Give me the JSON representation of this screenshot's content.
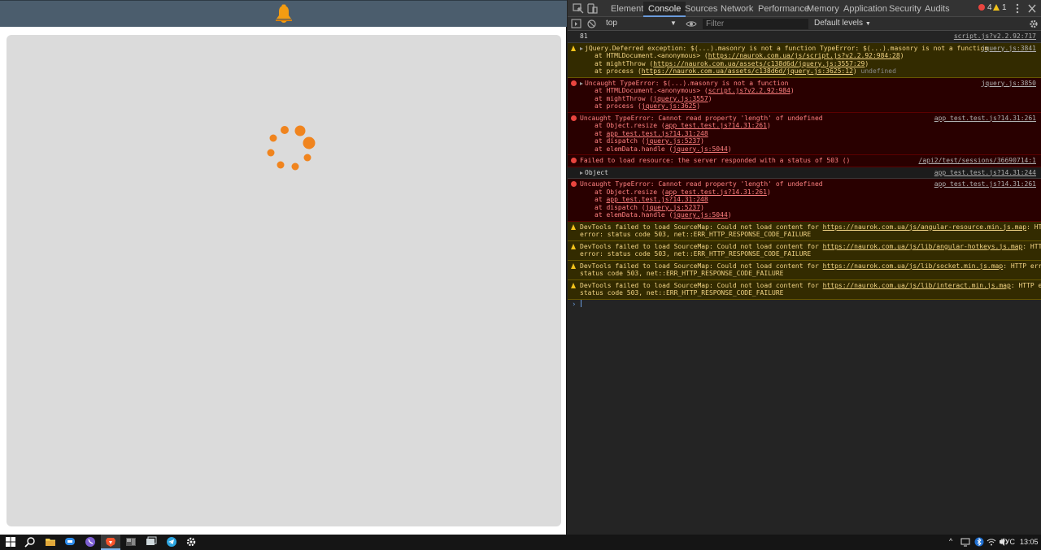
{
  "devtools": {
    "tabs": [
      "Elements",
      "Console",
      "Sources",
      "Network",
      "Performance",
      "Memory",
      "Application",
      "Security",
      "Audits"
    ],
    "active_tab": "Console",
    "error_count": "4",
    "warning_count": "1"
  },
  "toolbar": {
    "context": "top",
    "filter_placeholder": "Filter",
    "levels": "Default levels"
  },
  "console": {
    "r0": {
      "text": "81",
      "src": "script.js?v2.2.92:717"
    },
    "r1": {
      "l1": "jQuery.Deferred exception: $(...).masonry is not a function TypeError: $(...).masonry is not a function",
      "src": "jquery.js:3841",
      "l2a": "at HTMLDocument.<anonymous> (",
      "l2b": "https://naurok.com.ua/js/script.js?v2.2.92:984:28",
      "l2c": ")",
      "l3a": "at mightThrow (",
      "l3b": "https://naurok.com.ua/assets/c138d6d/jquery.js:3557:29",
      "l3c": ")",
      "l4a": "at process (",
      "l4b": "https://naurok.com.ua/assets/c138d6d/jquery.js:3625:12",
      "l4c": ") ",
      "l4d": "undefined"
    },
    "r2": {
      "l1": "Uncaught TypeError: $(...).masonry is not a function",
      "src": "jquery.js:3850",
      "l2a": "at HTMLDocument.<anonymous> (",
      "l2b": "script.js?v2.2.92:984",
      "l2c": ")",
      "l3a": "at mightThrow (",
      "l3b": "jquery.js:3557",
      "l3c": ")",
      "l4a": "at process (",
      "l4b": "jquery.js:3625",
      "l4c": ")"
    },
    "r3": {
      "l1": "Uncaught TypeError: Cannot read property 'length' of undefined",
      "src": "app_test.test.js?14.31:261",
      "l2a": "at Object.resize (",
      "l2b": "app_test.test.js?14.31:261",
      "l2c": ")",
      "l3a": "at ",
      "l3b": "app_test.test.js?14.31:248",
      "l4a": "at dispatch (",
      "l4b": "jquery.js:5237",
      "l4c": ")",
      "l5a": "at elemData.handle (",
      "l5b": "jquery.js:5044",
      "l5c": ")"
    },
    "r4": {
      "text": "Failed to load resource: the server responded with a status of 503 ()",
      "src": "/api2/test/sessions/36690714:1"
    },
    "r5": {
      "text": "Object",
      "src": "app_test.test.js?14.31:244"
    },
    "r6": {
      "l1": "Uncaught TypeError: Cannot read property 'length' of undefined",
      "src": "app_test.test.js?14.31:261",
      "l2a": "at Object.resize (",
      "l2b": "app_test.test.js?14.31:261",
      "l2c": ")",
      "l3a": "at ",
      "l3b": "app_test.test.js?14.31:248",
      "l4a": "at dispatch (",
      "l4b": "jquery.js:5237",
      "l4c": ")",
      "l5a": "at elemData.handle (",
      "l5b": "jquery.js:5044",
      "l5c": ")"
    },
    "r7": {
      "a": "DevTools failed to load SourceMap: Could not load content for ",
      "b": "https://naurok.com.ua/js/angular-resource.min.js.map",
      "c": ": HTTP",
      "d": "error: status code 503, net::ERR_HTTP_RESPONSE_CODE_FAILURE"
    },
    "r8": {
      "a": "DevTools failed to load SourceMap: Could not load content for ",
      "b": "https://naurok.com.ua/js/lib/angular-hotkeys.js.map",
      "c": ": HTTP",
      "d": "error: status code 503, net::ERR_HTTP_RESPONSE_CODE_FAILURE"
    },
    "r9": {
      "a": "DevTools failed to load SourceMap: Could not load content for ",
      "b": "https://naurok.com.ua/js/lib/socket.min.js.map",
      "c": ": HTTP error:",
      "d": "status code 503, net::ERR_HTTP_RESPONSE_CODE_FAILURE"
    },
    "r10": {
      "a": "DevTools failed to load SourceMap: Could not load content for ",
      "b": "https://naurok.com.ua/js/lib/interact.min.js.map",
      "c": ": HTTP error:",
      "d": "status code 503, net::ERR_HTTP_RESPONSE_CODE_FAILURE"
    },
    "prompt": "›"
  },
  "taskbar": {
    "tray_up": "^",
    "language": "РУС",
    "time": "13:05"
  },
  "colors": {
    "header": "#4b5d6d",
    "bell": "#f39c12",
    "spinner": "#f0841e",
    "error": "#e9453f",
    "warning": "#f1c21b"
  },
  "icons": {
    "page": [
      "bell-icon",
      "loading-spinner"
    ],
    "devtools": [
      "inspect-element-icon",
      "device-toolbar-icon",
      "sidebar-toggle-icon",
      "clear-console-icon",
      "eye-icon",
      "kebab-menu-icon",
      "settings-gear-icon"
    ],
    "taskbar": [
      "windows-start-icon",
      "search-icon",
      "file-explorer-icon",
      "chat-icon",
      "viber-icon",
      "brave-browser-icon",
      "app-icon",
      "window-icon",
      "telegram-icon",
      "settings-icon",
      "network-icon",
      "volume-icon",
      "bluetooth-icon",
      "wifi-icon",
      "notification-icon"
    ]
  }
}
